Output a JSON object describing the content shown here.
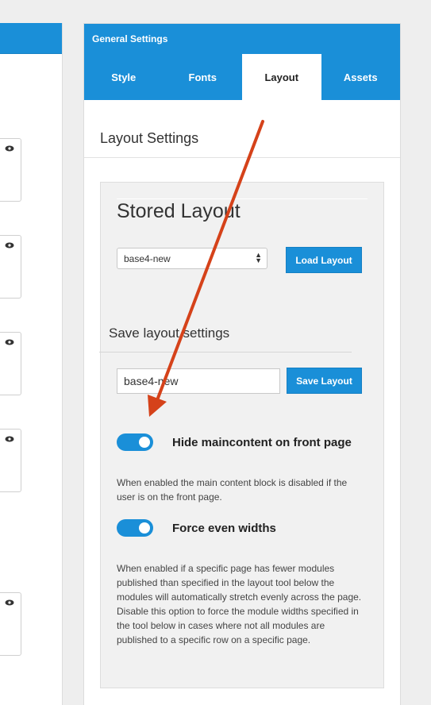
{
  "panel": {
    "header_title": "General Settings",
    "tabs": [
      {
        "label": "Style"
      },
      {
        "label": "Fonts"
      },
      {
        "label": "Layout"
      },
      {
        "label": "Assets"
      }
    ],
    "active_tab": "Layout",
    "section_title": "Layout Settings"
  },
  "stored_layout": {
    "title": "Stored Layout",
    "select_value": "base4-new",
    "load_button": "Load Layout"
  },
  "save_layout": {
    "title": "Save layout settings",
    "input_value": "base4-new",
    "save_button": "Save Layout"
  },
  "options": [
    {
      "label": "Hide maincontent on front page",
      "enabled": true,
      "help": "When enabled the main content block is disabled if the user is on the front page."
    },
    {
      "label": "Force even widths",
      "enabled": true,
      "help": "When enabled if a specific page has fewer modules published than specified in the layout tool below the modules will automatically stretch evenly across the page. Disable this option to force the module widths specified in the tool below in cases where not all modules are published to a specific row on a specific page."
    }
  ],
  "colors": {
    "accent": "#1a8fd8",
    "annotation_arrow": "#d5421a",
    "panel_bg": "#ffffff",
    "inner_bg": "#f1f1f1"
  },
  "icons": {
    "module_visibility": "eye-icon",
    "select_arrows": "updown-arrows-icon"
  }
}
